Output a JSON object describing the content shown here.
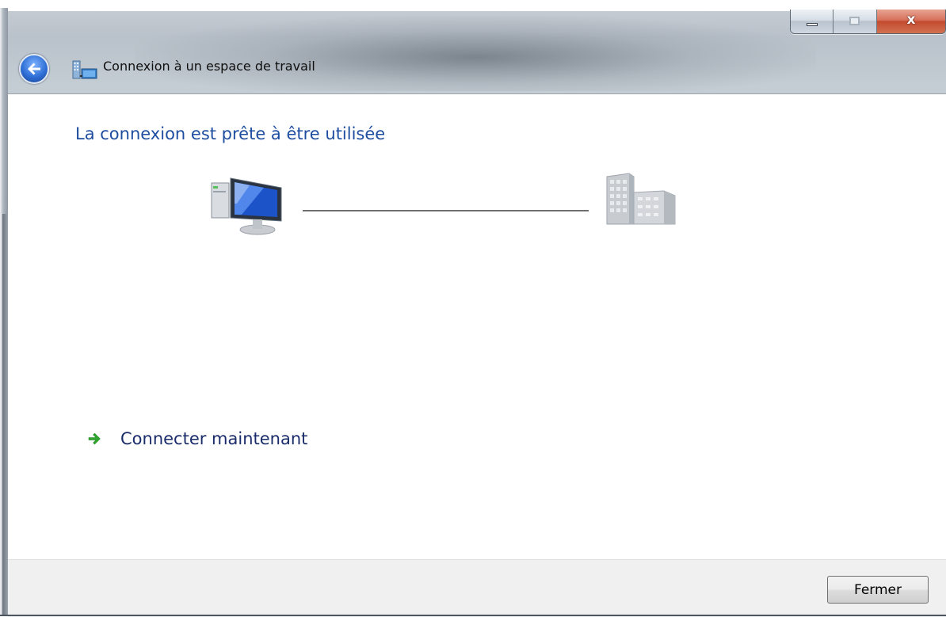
{
  "window": {
    "title": "Connexion à un espace de travail",
    "caption_close_glyph": "x"
  },
  "icons": {
    "back": "back-arrow-icon",
    "title": "network-workplace-icon",
    "computer": "computer-icon",
    "server": "server-building-icon",
    "connect_arrow": "green-arrow-icon"
  },
  "main": {
    "heading": "La connexion est prête à être utilisée",
    "connect_link": "Connecter maintenant"
  },
  "footer": {
    "close_label": "Fermer"
  },
  "colors": {
    "heading": "#1f4ea0",
    "link": "#1b2c6a",
    "arrow": "#2ea62e"
  }
}
